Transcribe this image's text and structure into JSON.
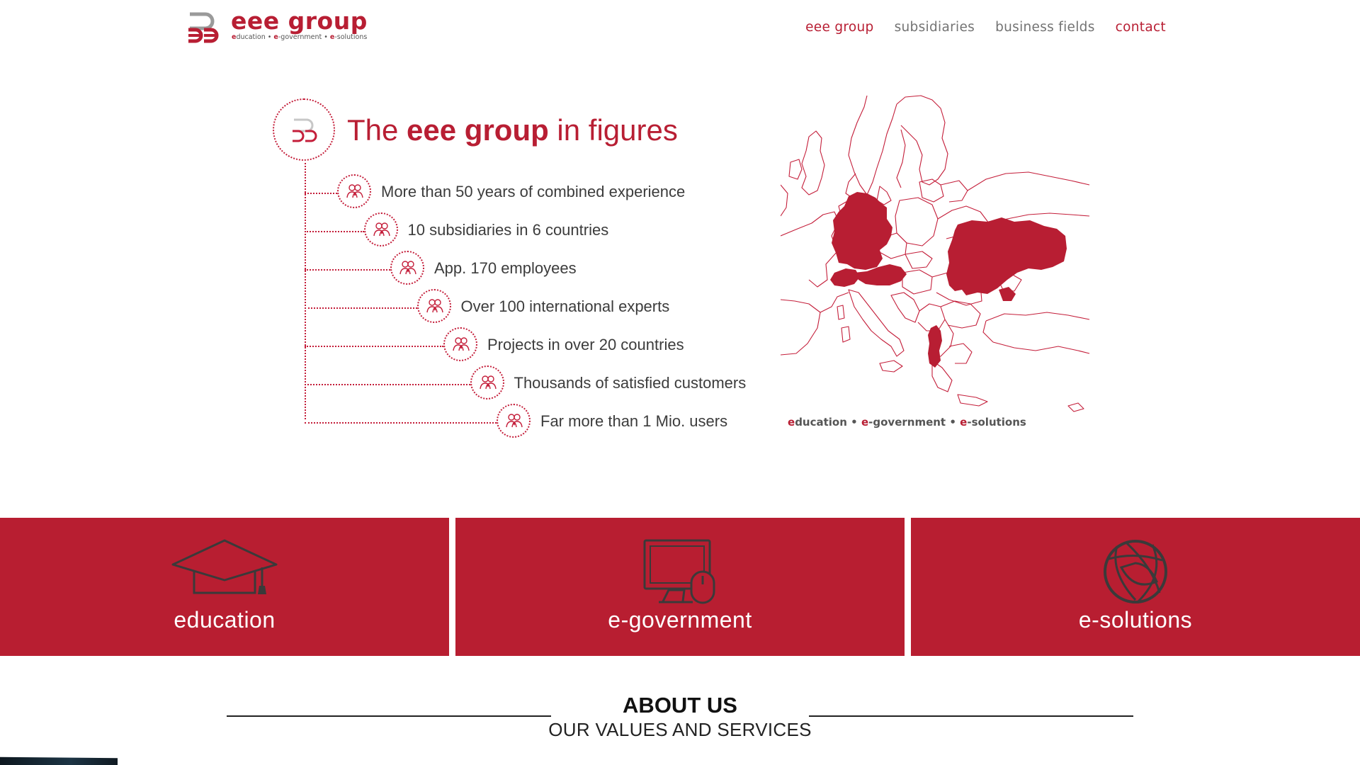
{
  "brand": {
    "name": "eee group",
    "tagline_parts": [
      {
        "e": "e",
        "rest": "ducation"
      },
      {
        "sep": " • "
      },
      {
        "e": "e",
        "rest": "-government"
      },
      {
        "sep": " • "
      },
      {
        "e": "e",
        "rest": "-solutions"
      }
    ],
    "accent_color": "#b81e33"
  },
  "nav": {
    "items": [
      {
        "label": "eee group",
        "active": true
      },
      {
        "label": "subsidiaries",
        "active": false
      },
      {
        "label": "business fields",
        "active": false
      },
      {
        "label": "contact",
        "active": true
      }
    ]
  },
  "figures": {
    "title_pre": "The ",
    "title_bold": "eee group",
    "title_post": " in figures",
    "facts": [
      "More than 50 years of combined experience",
      "10 subsidiaries in 6 countries",
      "App. 170 employees",
      "Over 100 international experts",
      "Projects in over 20 countries",
      "Thousands of satisfied customers",
      "Far more than 1 Mio. users"
    ],
    "icon": "people-icon"
  },
  "map": {
    "icon": "europe-map",
    "highlighted": [
      "Germany",
      "Austria",
      "Switzerland",
      "Ukraine",
      "Albania"
    ],
    "tagline": {
      "a_e": "e",
      "a": "ducation",
      "sep1": " • ",
      "b_e": "e",
      "b": "-government",
      "sep2": " • ",
      "c_e": "e",
      "c": "-solutions"
    }
  },
  "tiles": [
    {
      "label": "education",
      "icon": "graduation-cap-icon"
    },
    {
      "label": "e-government",
      "icon": "computer-monitor-icon"
    },
    {
      "label": "e-solutions",
      "icon": "globe-icon"
    }
  ],
  "about": {
    "title": "ABOUT US",
    "subtitle": "OUR VALUES AND SERVICES"
  }
}
